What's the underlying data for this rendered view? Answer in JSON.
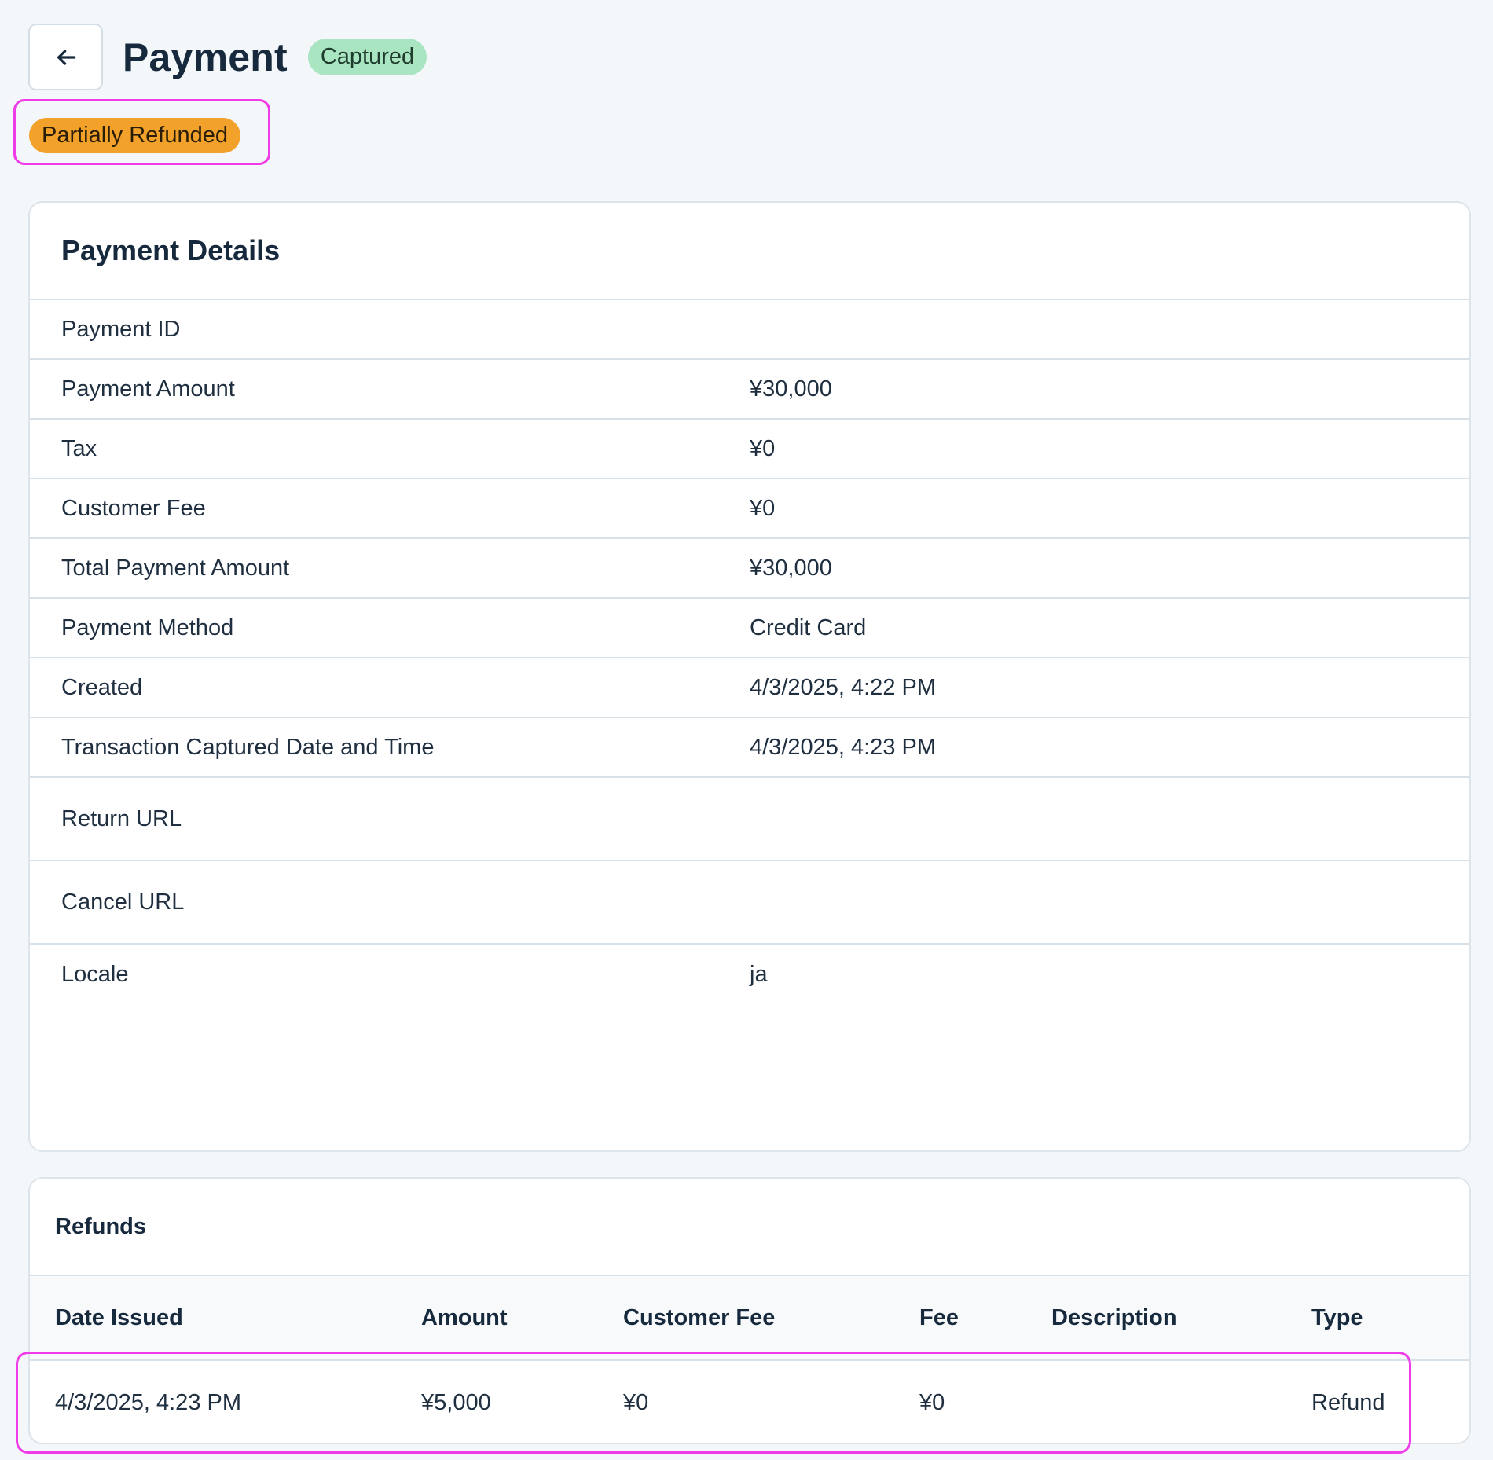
{
  "header": {
    "title": "Payment",
    "status_badge": "Captured",
    "refund_badge": "Partially Refunded"
  },
  "details": {
    "title": "Payment Details",
    "rows": [
      {
        "label": "Payment ID",
        "value": ""
      },
      {
        "label": "Payment Amount",
        "value": "¥30,000"
      },
      {
        "label": "Tax",
        "value": "¥0"
      },
      {
        "label": "Customer Fee",
        "value": "¥0"
      },
      {
        "label": "Total Payment Amount",
        "value": "¥30,000"
      },
      {
        "label": "Payment Method",
        "value": "Credit Card"
      },
      {
        "label": "Created",
        "value": "4/3/2025, 4:22 PM"
      },
      {
        "label": "Transaction Captured Date and Time",
        "value": "4/3/2025, 4:23 PM"
      },
      {
        "label": "Return URL",
        "value": ""
      },
      {
        "label": "Cancel URL",
        "value": ""
      },
      {
        "label": "Locale",
        "value": "ja"
      }
    ]
  },
  "refunds": {
    "title": "Refunds",
    "columns": [
      "Date Issued",
      "Amount",
      "Customer Fee",
      "Fee",
      "Description",
      "Type"
    ],
    "rows": [
      [
        "4/3/2025, 4:23 PM",
        "¥5,000",
        "¥0",
        "¥0",
        "",
        "Refund"
      ]
    ]
  },
  "colors": {
    "captured_badge": "#a9e5c1",
    "partial_badge": "#f2a22a",
    "highlight": "#f03ce8"
  },
  "icons": {
    "back": "arrow-left-icon"
  }
}
